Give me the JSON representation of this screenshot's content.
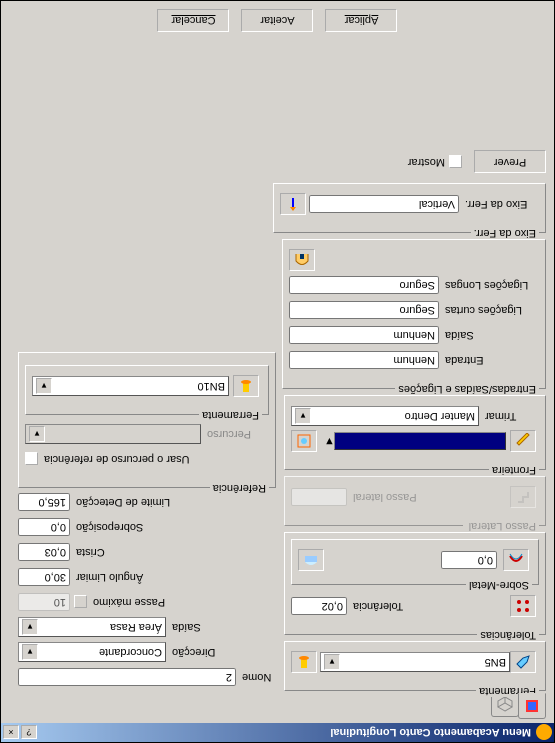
{
  "window": {
    "title": "Menu Acabamento Canto Longitudinal",
    "help": "?",
    "close": "×"
  },
  "left": {
    "ferramenta": {
      "label": "Ferramenta",
      "value": "BN5"
    },
    "tolerancias": {
      "label": "Tolerâncias",
      "tolerancia_label": "Tolerância",
      "tolerancia": "0,02",
      "sobremetal_label": "Sobre-Metal",
      "sobremetal": "0,0"
    },
    "passo_lateral": {
      "group": "Passo Lateral",
      "label": "Passo lateral"
    },
    "fronteira": {
      "label": "Fronteira",
      "trimar_label": "Trimar",
      "trimar": "Manter Dentro"
    },
    "esl": {
      "group": "Entradas/Saídas e Ligações",
      "entrada_label": "Entrada",
      "entrada": "Nenhum",
      "saida_label": "Saída",
      "saida": "Nenhum",
      "curtas_label": "Ligações curtas",
      "curtas": "Seguro",
      "longas_label": "Ligações Longas",
      "longas": "Seguro"
    },
    "eixo_group": "Eixo da Ferr.",
    "eixo_label": "Eixo da Ferr.",
    "eixo": "Vertical",
    "prever": "Prever",
    "mostrar": "Mostrar"
  },
  "right": {
    "nome_label": "Nome",
    "nome": "2",
    "direccao_label": "Direcção",
    "direccao": "Concordante",
    "saida_label": "Saída",
    "saida": "Área Rasa",
    "passe_label": "Passe máximo",
    "passe": "10",
    "angulo_label": "Ângulo Limiar",
    "angulo": "30,0",
    "crista_label": "Crista",
    "crista": "0,03",
    "sobre_label": "Sobreposição",
    "sobre": "0,0",
    "limdet_label": "Limite de Detecção",
    "limdet": "165,0",
    "referencia_group": "Referência",
    "usar_perc": "Usar o percurso de referência",
    "percurso_label": "Percurso",
    "ferramenta_group": "Ferramenta",
    "ferramenta_value": "BN10"
  },
  "buttons": {
    "aplicar": "Aplicar",
    "aceitar": "Aceitar",
    "cancelar": "Cancelar"
  }
}
